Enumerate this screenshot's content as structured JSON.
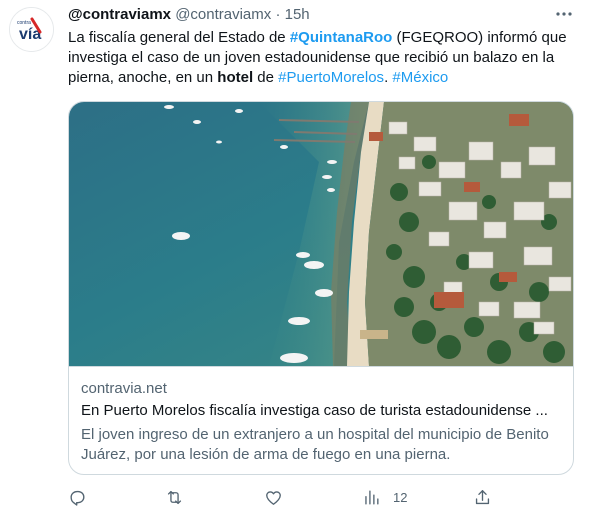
{
  "tweet": {
    "author_name": "@contraviamx",
    "author_handle": "@contraviamx",
    "dot": "·",
    "time": "15h",
    "avatar_text": "vía",
    "avatar_small_text": "contra",
    "text": {
      "part1": "La fiscalía general del Estado de ",
      "tag1": "#QuintanaRoo",
      "part2": " (FGEQROO) informó que investiga el caso de un joven estadounidense que recibió un balazo en la pierna, anoche, en un ",
      "bold_word": "hotel",
      "part3": " de ",
      "tag2": "#PuertoMorelos",
      "part4": ". ",
      "tag3": "#México"
    },
    "card": {
      "domain": "contravia.net",
      "title": "En Puerto Morelos fiscalía investiga caso de turista estadounidense ...",
      "description": "El joven ingreso de un extranjero a un hospital del municipio de Benito Juárez, por una lesión de arma de fuego en una pierna."
    },
    "actions": {
      "reply_icon": "reply-icon",
      "retweet_icon": "retweet-icon",
      "like_icon": "heart-icon",
      "views_icon": "views-icon",
      "views_count": "12",
      "share_icon": "share-icon"
    }
  },
  "colors": {
    "accent": "#1d9bf0",
    "text_primary": "#0f1419",
    "text_secondary": "#536471",
    "border": "#cfd9de"
  }
}
